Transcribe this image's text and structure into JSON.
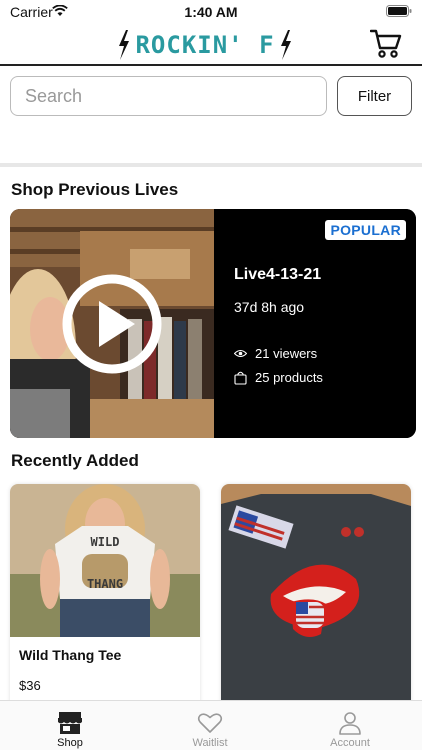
{
  "status_bar": {
    "carrier": "Carrier",
    "time": "1:40 AM"
  },
  "header": {
    "logo_text": "ROCKIN' F",
    "brand_color": "#2a9aa0"
  },
  "search": {
    "placeholder": "Search",
    "value": ""
  },
  "filter_label": "Filter",
  "sections": {
    "previous_lives_title": "Shop Previous Lives",
    "recently_added_title": "Recently Added"
  },
  "live": {
    "badge": "POPULAR",
    "badge_color": "#1b6fd1",
    "title": "Live4-13-21",
    "ago": "37d 8h ago",
    "viewers": "21 viewers",
    "products": "25 products"
  },
  "products": [
    {
      "name": "Wild Thang Tee",
      "price": "$36"
    },
    {
      "name": "",
      "price": ""
    }
  ],
  "tabs": [
    {
      "label": "Shop",
      "icon": "store-icon",
      "active": true
    },
    {
      "label": "Waitlist",
      "icon": "heart-icon",
      "active": false
    },
    {
      "label": "Account",
      "icon": "person-icon",
      "active": false
    }
  ]
}
